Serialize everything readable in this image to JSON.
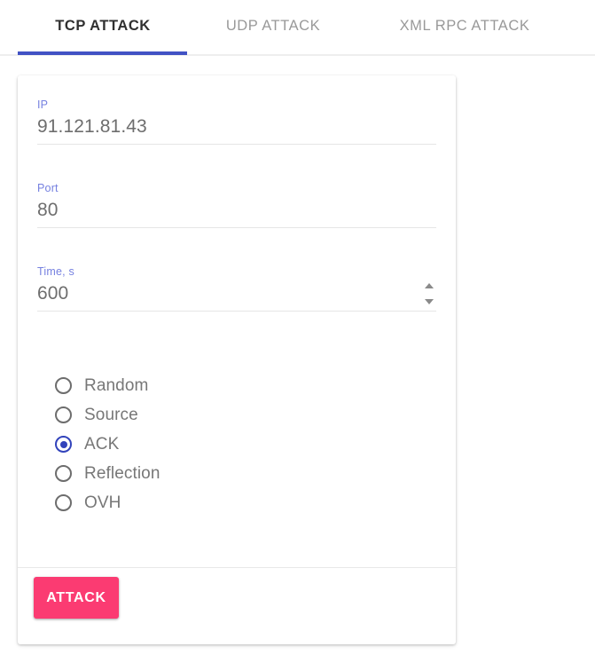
{
  "colors": {
    "tab_active_text": "#303030",
    "tab_inactive_text": "#999999",
    "tab_indicator": "#4152c4",
    "field_label": "#7681e0",
    "field_value": "#6e6e6e",
    "radio_selected": "#3243bb",
    "radio_unselected": "#6d6d6d",
    "radio_label": "#777777",
    "attack_button_bg": "#fb3b72",
    "attack_button_text": "#ffffff",
    "page_background": "#ffffff"
  },
  "tabs": [
    {
      "label": "TCP ATTACK",
      "active": true
    },
    {
      "label": "UDP ATTACK",
      "active": false
    },
    {
      "label": "XML RPC ATTACK",
      "active": false
    }
  ],
  "form": {
    "fields": [
      {
        "label": "IP",
        "value": "91.121.81.43",
        "has_spinner": false
      },
      {
        "label": "Port",
        "value": "80",
        "has_spinner": false
      },
      {
        "label": "Time, s",
        "value": "600",
        "has_spinner": true
      }
    ],
    "attack_mode": {
      "selected": "ACK",
      "options": [
        {
          "label": "Random",
          "checked": false
        },
        {
          "label": "Source",
          "checked": false
        },
        {
          "label": "ACK",
          "checked": true
        },
        {
          "label": "Reflection",
          "checked": false
        },
        {
          "label": "OVH",
          "checked": false
        }
      ]
    },
    "submit_label": "ATTACK"
  }
}
